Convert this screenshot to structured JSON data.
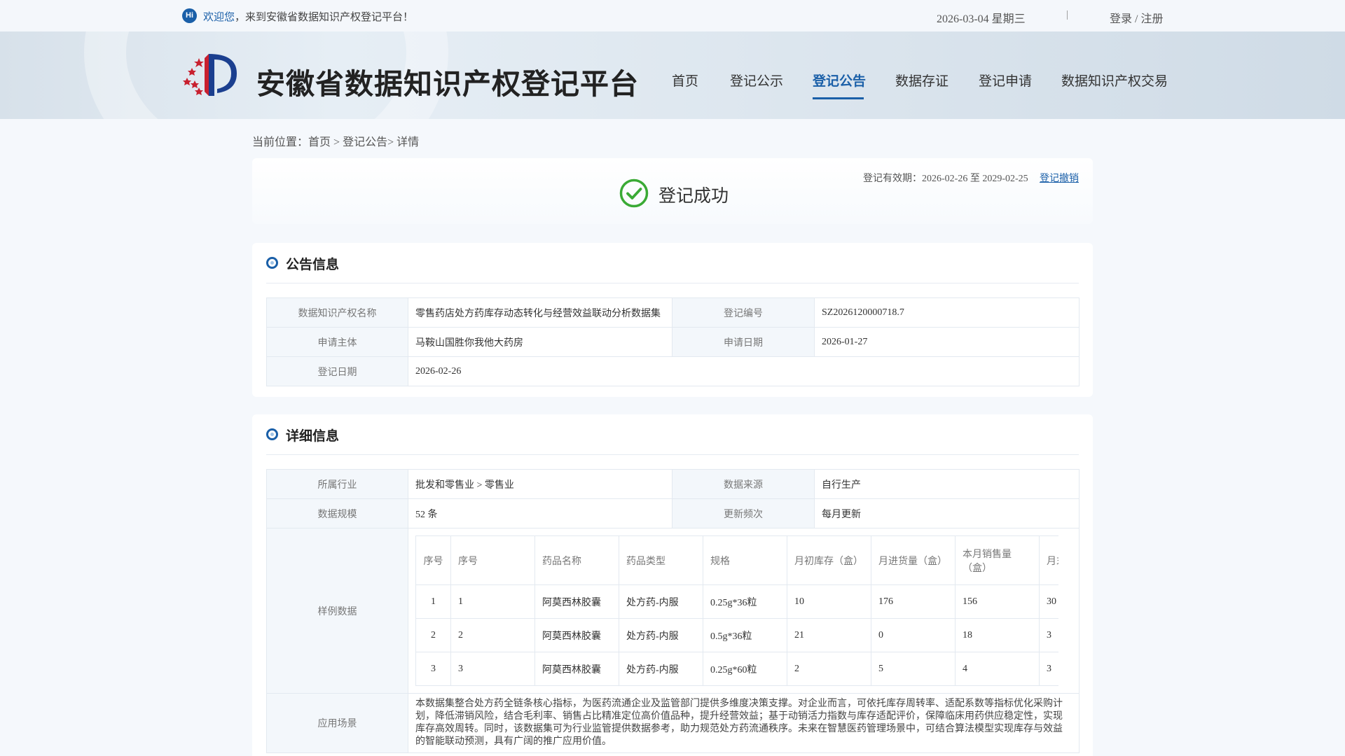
{
  "topbar": {
    "hi": "Hi",
    "welcome_accent": "欢迎您",
    "welcome_rest": "，来到安徽省数据知识产权登记平台！",
    "date": "2026-03-04 星期三",
    "separator": "|",
    "login": "登录 / 注册"
  },
  "header": {
    "logo_text": "安徽省数据知识产权登记平台",
    "nav": [
      "首页",
      "登记公示",
      "登记公告",
      "数据存证",
      "登记申请",
      "数据知识产权交易"
    ],
    "active_nav": "登记公告"
  },
  "breadcrumb": {
    "prefix": "当前位置：",
    "home": "首页",
    "sep1": " > ",
    "section": "登记公告",
    "sep2": "> ",
    "current": "详情"
  },
  "status": {
    "title": "登记成功",
    "validity": "登记有效期：2026-02-26 至 2029-02-25",
    "revoke": "登记撤销",
    "success_color": "#3aaa35"
  },
  "announcement": {
    "title": "公告信息",
    "name_label": "数据知识产权名称",
    "name_value": "零售药店处方药库存动态转化与经营效益联动分析数据集",
    "code_label": "登记编号",
    "code_value": "SZ2026120000718.7",
    "applicant_label": "申请主体",
    "applicant_value": "马鞍山国胜你我他大药房",
    "apply_date_label": "申请日期",
    "apply_date_value": "2026-01-27",
    "reg_date_label": "登记日期",
    "reg_date_value": "2026-02-26"
  },
  "details": {
    "title": "详细信息",
    "industry_label": "所属行业",
    "industry_value": "批发和零售业 > 零售业",
    "source_label": "数据来源",
    "source_value": "自行生产",
    "scale_label": "数据规模",
    "scale_value": "52 条",
    "frequency_label": "更新频次",
    "frequency_value": "每月更新",
    "sample_label": "样例数据",
    "sample": {
      "headers": [
        "序号",
        "序号",
        "药品名称",
        "药品类型",
        "规格",
        "月初库存（盒）",
        "月进货量（盒）",
        "本月销售量（盒）",
        "月末"
      ],
      "rows": [
        [
          "1",
          "1",
          "阿莫西林胶囊",
          "处方药-内服",
          "0.25g*36粒",
          "10",
          "176",
          "156",
          "30"
        ],
        [
          "2",
          "2",
          "阿莫西林胶囊",
          "处方药-内服",
          "0.5g*36粒",
          "21",
          "0",
          "18",
          "3"
        ],
        [
          "3",
          "3",
          "阿莫西林胶囊",
          "处方药-内服",
          "0.25g*60粒",
          "2",
          "5",
          "4",
          "3"
        ]
      ]
    },
    "scenario_label": "应用场景",
    "scenario_value": "本数据集整合处方药全链条核心指标，为医药流通企业及监管部门提供多维度决策支撑。对企业而言，可依托库存周转率、适配系数等指标优化采购计划，降低滞销风险，结合毛利率、销售占比精准定位高价值品种，提升经营效益；基于动销活力指数与库存适配评价，保障临床用药供应稳定性，实现库存高效周转。同时，该数据集可为行业监管提供数据参考，助力规范处方药流通秩序。未来在智慧医药管理场景中，可结合算法模型实现库存与效益的智能联动预测，具有广阔的推广应用价值。"
  }
}
